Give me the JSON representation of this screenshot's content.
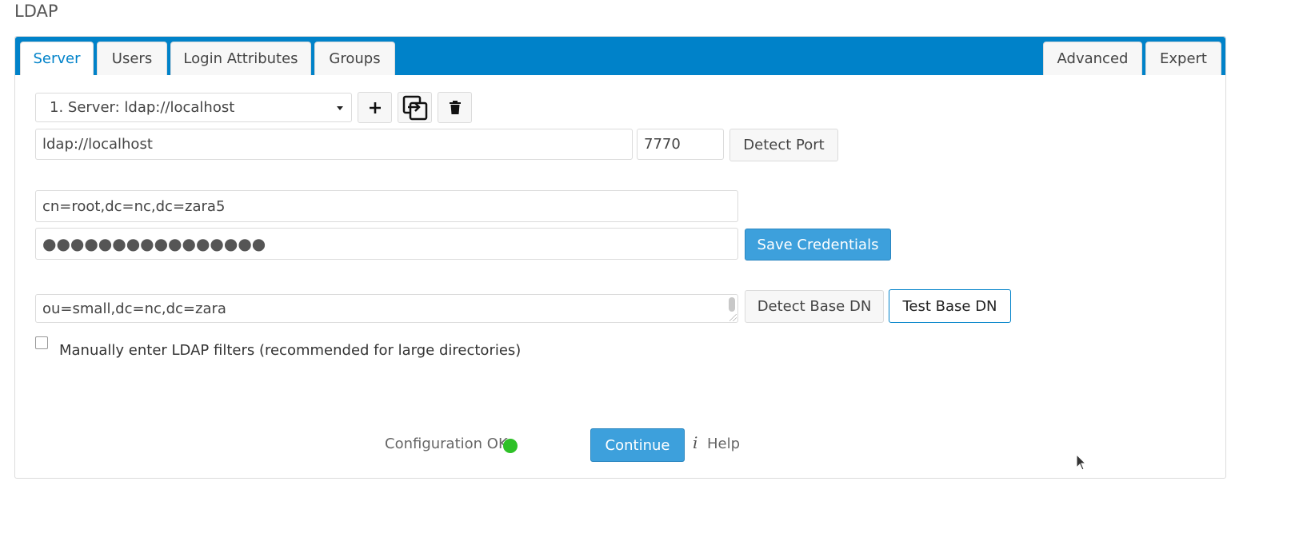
{
  "page": {
    "title": "LDAP"
  },
  "tabs": {
    "left": [
      {
        "label": "Server",
        "active": true
      },
      {
        "label": "Users",
        "active": false
      },
      {
        "label": "Login Attributes",
        "active": false
      },
      {
        "label": "Groups",
        "active": false
      }
    ],
    "right": [
      {
        "label": "Advanced"
      },
      {
        "label": "Expert"
      }
    ]
  },
  "server": {
    "config_select": "1. Server: ldap://localhost",
    "add_icon": "plus-icon",
    "copy_icon": "copy-config-icon",
    "delete_icon": "trash-icon",
    "host": "ldap://localhost",
    "port": "7770",
    "detect_port_label": "Detect Port",
    "user_dn": "cn=root,dc=nc,dc=zara5",
    "password_mask": "●●●●●●●●●●●●●●●●",
    "save_credentials_label": "Save Credentials",
    "base_dn": "ou=small,dc=nc,dc=zara",
    "detect_base_dn_label": "Detect Base DN",
    "test_base_dn_label": "Test Base DN",
    "manual_filters_label": "Manually enter LDAP filters (recommended for large directories)",
    "manual_filters_checked": false
  },
  "footer": {
    "status_text": "Configuration OK",
    "status_color": "#2ec127",
    "continue_label": "Continue",
    "help_glyph": "i",
    "help_label": "Help"
  },
  "colors": {
    "accent": "#0082c9",
    "primary_button": "#3da0dc"
  }
}
